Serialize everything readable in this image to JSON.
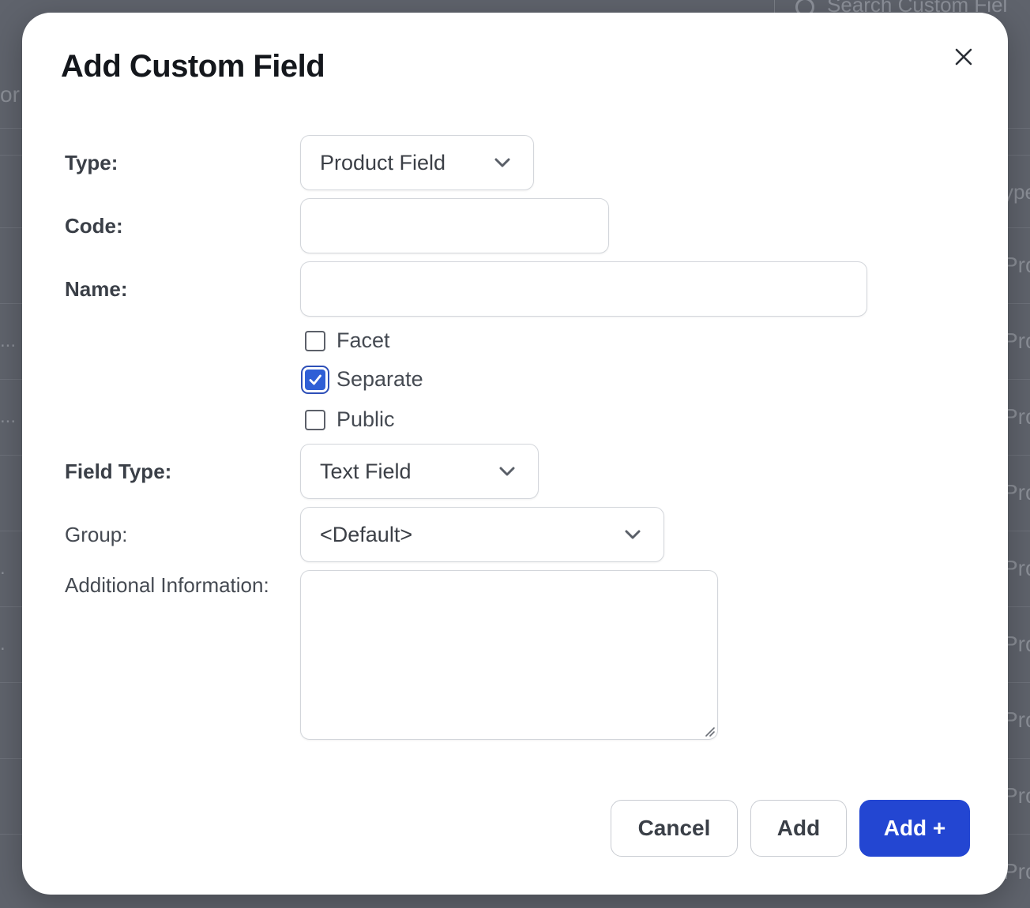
{
  "background": {
    "search_placeholder": "Search Custom Fiel",
    "header_fragment_left": "or",
    "column_fragment_right": "ype",
    "row_fragments_right": [
      "Pro",
      "Pro",
      "Pro",
      "Pro",
      "Pro",
      "Pro",
      "Pro",
      "Pro",
      "Pro"
    ],
    "row_fragments_left": [
      "...",
      "...",
      ".",
      "."
    ]
  },
  "modal": {
    "title": "Add Custom Field",
    "close_icon": "close-icon",
    "fields": {
      "type": {
        "label": "Type:",
        "value": "Product Field"
      },
      "code": {
        "label": "Code:",
        "value": ""
      },
      "name": {
        "label": "Name:",
        "value": ""
      },
      "field_type": {
        "label": "Field Type:",
        "value": "Text Field"
      },
      "group": {
        "label": "Group:",
        "value": "<Default>"
      },
      "additional_info": {
        "label": "Additional Information:",
        "value": ""
      }
    },
    "checkboxes": [
      {
        "label": "Facet",
        "checked": false
      },
      {
        "label": "Separate",
        "checked": true
      },
      {
        "label": "Public",
        "checked": false
      }
    ],
    "buttons": {
      "cancel": "Cancel",
      "add": "Add",
      "add_plus": "Add +"
    }
  },
  "colors": {
    "primary": "#2346d2",
    "overlay": "#5f636c",
    "checkbox_checked": "#2f5fd6"
  }
}
